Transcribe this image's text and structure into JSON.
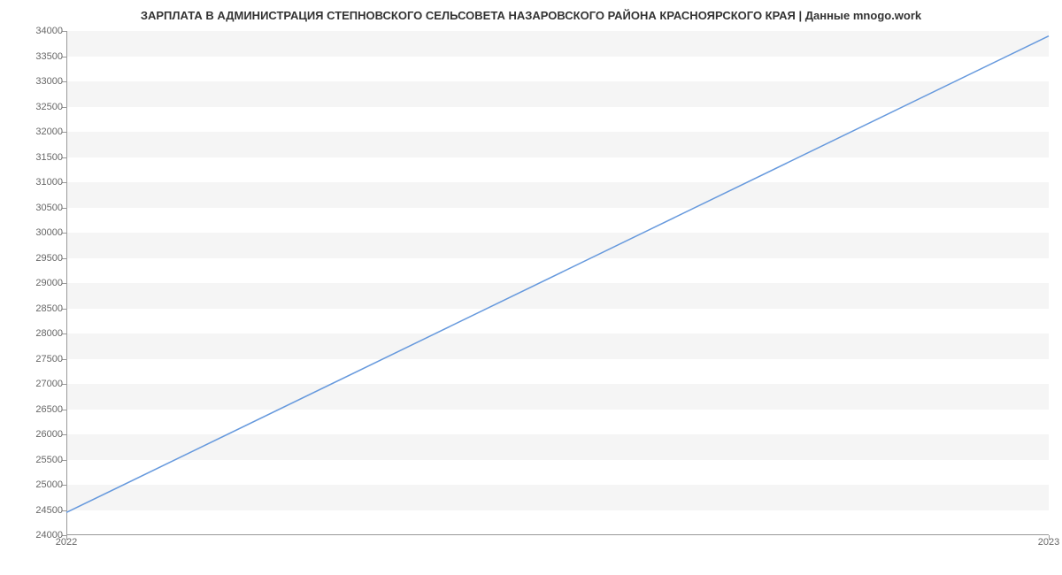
{
  "chart_data": {
    "type": "line",
    "title": "ЗАРПЛАТА В АДМИНИСТРАЦИЯ СТЕПНОВСКОГО СЕЛЬСОВЕТА НАЗАРОВСКОГО РАЙОНА КРАСНОЯРСКОГО КРАЯ | Данные mnogo.work",
    "x": [
      2022,
      2023
    ],
    "values": [
      24450,
      33900
    ],
    "xlabel": "",
    "ylabel": "",
    "ylim": [
      24000,
      34000
    ],
    "y_ticks": [
      24000,
      24500,
      25000,
      25500,
      26000,
      26500,
      27000,
      27500,
      28000,
      28500,
      29000,
      29500,
      30000,
      30500,
      31000,
      31500,
      32000,
      32500,
      33000,
      33500,
      34000
    ],
    "x_ticks": [
      2022,
      2023
    ],
    "line_color": "#6699dd"
  }
}
